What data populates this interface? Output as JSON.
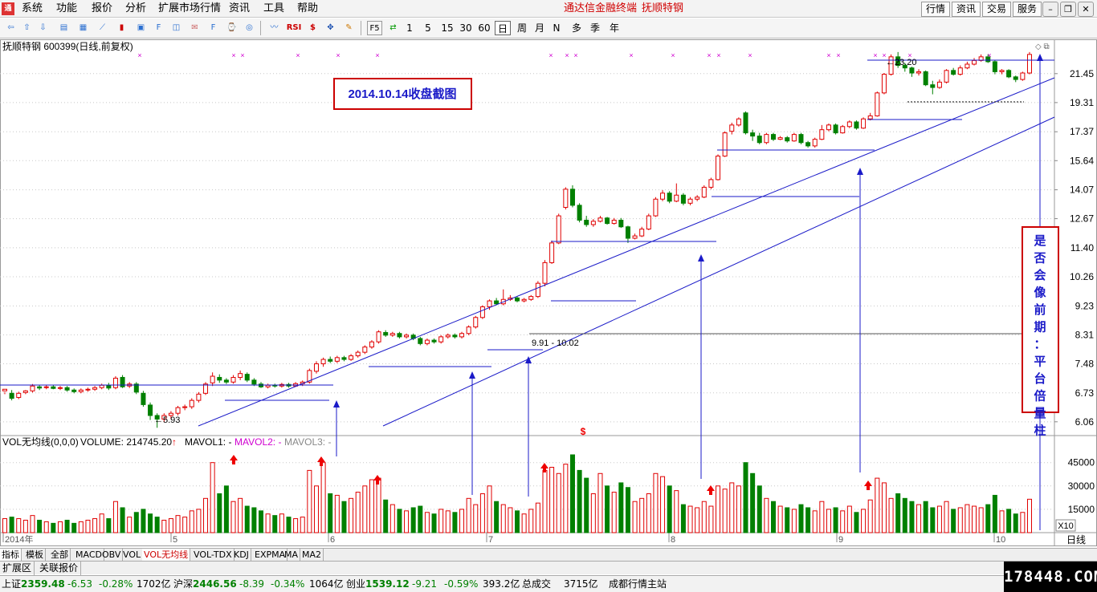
{
  "menu": {
    "items": [
      "系统",
      "功能",
      "报价",
      "分析",
      "扩展市场行情",
      "资讯",
      "工具",
      "帮助"
    ],
    "title_app": "通达信金融终端",
    "title_stock": "抚顺特钢",
    "right_buttons": [
      "行情",
      "资讯",
      "交易",
      "服务"
    ]
  },
  "toolbar": {
    "periods": [
      "1",
      "5",
      "15",
      "30",
      "60",
      "日",
      "周",
      "月",
      "N",
      "多",
      "季",
      "年"
    ],
    "active_period": "日",
    "rsi_label": "RSI",
    "f5_label": "F5"
  },
  "chart": {
    "header": "抚顺特钢 600399(日线,前复权)",
    "annotation_box": "2014.10.14收盘截图",
    "side_note": "是否会像前期：平台倍量柱",
    "low_label": "5.93",
    "high_label": "23.20",
    "gap_label": "9.91 - 10.02",
    "price_ticks": [
      "21.45",
      "19.31",
      "17.37",
      "15.64",
      "14.07",
      "12.67",
      "11.40",
      "10.26",
      "9.23",
      "8.31",
      "7.48",
      "6.73",
      "6.06"
    ],
    "volume_header": {
      "name": "VOL无均线(0,0,0)",
      "volume": "VOLUME: 214745.20",
      "mavol1": "MAVOL1: -",
      "mavol2": "MAVOL2: -",
      "mavol3": "MAVOL3: -"
    },
    "volume_ticks": [
      "45000",
      "30000",
      "15000"
    ],
    "vol_unit": "X10",
    "dollar_mark": "$",
    "date_labels": [
      "2014年",
      "5",
      "6",
      "7",
      "8",
      "9",
      "10"
    ],
    "right_label": "日线"
  },
  "chart_data": {
    "type": "candlestick",
    "title": "抚顺特钢 600399(日线,前复权)",
    "price_scale": "log",
    "ylim": [
      5.9,
      23.6
    ],
    "volume_ylim": [
      0,
      50000
    ],
    "candles": [
      [
        6.78,
        6.82,
        6.75,
        6.7,
        9000,
        1
      ],
      [
        6.72,
        6.6,
        6.8,
        6.55,
        10000,
        0
      ],
      [
        6.62,
        6.72,
        6.76,
        6.58,
        9000,
        1
      ],
      [
        6.74,
        6.78,
        6.8,
        6.7,
        8000,
        1
      ],
      [
        6.78,
        6.9,
        6.95,
        6.74,
        11000,
        1
      ],
      [
        6.88,
        6.85,
        6.92,
        6.8,
        8000,
        0
      ],
      [
        6.86,
        6.88,
        6.92,
        6.82,
        7000,
        1
      ],
      [
        6.88,
        6.84,
        6.92,
        6.82,
        6000,
        0
      ],
      [
        6.84,
        6.86,
        6.9,
        6.8,
        7000,
        1
      ],
      [
        6.86,
        6.8,
        6.9,
        6.76,
        8000,
        0
      ],
      [
        6.8,
        6.76,
        6.84,
        6.72,
        6000,
        0
      ],
      [
        6.76,
        6.8,
        6.84,
        6.72,
        7000,
        1
      ],
      [
        6.8,
        6.82,
        6.86,
        6.76,
        8000,
        1
      ],
      [
        6.82,
        6.86,
        6.9,
        6.78,
        9000,
        1
      ],
      [
        6.86,
        6.92,
        6.96,
        6.82,
        12000,
        1
      ],
      [
        6.92,
        6.85,
        6.98,
        6.8,
        9000,
        0
      ],
      [
        6.86,
        7.1,
        7.15,
        6.82,
        20000,
        1
      ],
      [
        7.12,
        6.88,
        7.18,
        6.85,
        16000,
        0
      ],
      [
        6.9,
        6.95,
        7.0,
        6.85,
        10000,
        1
      ],
      [
        6.95,
        6.75,
        7.0,
        6.7,
        13000,
        0
      ],
      [
        6.72,
        6.45,
        6.78,
        6.4,
        15000,
        0
      ],
      [
        6.44,
        6.2,
        6.5,
        6.1,
        12000,
        0
      ],
      [
        6.2,
        6.12,
        6.25,
        5.93,
        10000,
        0
      ],
      [
        6.12,
        6.2,
        6.25,
        6.05,
        8000,
        1
      ],
      [
        6.2,
        6.25,
        6.3,
        6.12,
        9000,
        1
      ],
      [
        6.25,
        6.38,
        6.42,
        6.2,
        11000,
        1
      ],
      [
        6.38,
        6.4,
        6.45,
        6.32,
        10000,
        1
      ],
      [
        6.4,
        6.55,
        6.6,
        6.35,
        14000,
        1
      ],
      [
        6.55,
        6.7,
        6.75,
        6.5,
        15000,
        1
      ],
      [
        6.72,
        6.95,
        7.0,
        6.68,
        22000,
        1
      ],
      [
        6.98,
        7.15,
        7.25,
        6.9,
        45000,
        1
      ],
      [
        7.12,
        7.05,
        7.2,
        6.98,
        25000,
        0
      ],
      [
        7.05,
        7.0,
        7.1,
        6.95,
        30000,
        0
      ],
      [
        7.0,
        7.12,
        7.18,
        6.96,
        20000,
        1
      ],
      [
        7.12,
        7.22,
        7.3,
        7.05,
        22000,
        1
      ],
      [
        7.2,
        7.05,
        7.25,
        7.0,
        17000,
        0
      ],
      [
        7.05,
        6.95,
        7.1,
        6.9,
        16000,
        0
      ],
      [
        6.95,
        6.88,
        7.0,
        6.85,
        14000,
        0
      ],
      [
        6.88,
        6.92,
        6.96,
        6.84,
        12000,
        1
      ],
      [
        6.92,
        6.9,
        6.96,
        6.86,
        11000,
        0
      ],
      [
        6.9,
        6.94,
        6.98,
        6.86,
        12000,
        1
      ],
      [
        6.94,
        6.9,
        6.98,
        6.86,
        10000,
        0
      ],
      [
        6.9,
        6.96,
        7.0,
        6.88,
        9000,
        1
      ],
      [
        6.96,
        7.0,
        7.04,
        6.9,
        10000,
        1
      ],
      [
        7.0,
        7.3,
        7.35,
        6.96,
        40000,
        1
      ],
      [
        7.28,
        7.48,
        7.55,
        7.22,
        30000,
        1
      ],
      [
        7.48,
        7.6,
        7.65,
        7.4,
        45000,
        1
      ],
      [
        7.6,
        7.55,
        7.68,
        7.5,
        25000,
        0
      ],
      [
        7.55,
        7.65,
        7.7,
        7.5,
        24000,
        1
      ],
      [
        7.65,
        7.6,
        7.7,
        7.55,
        20000,
        0
      ],
      [
        7.6,
        7.7,
        7.75,
        7.56,
        22000,
        1
      ],
      [
        7.7,
        7.8,
        7.85,
        7.65,
        26000,
        1
      ],
      [
        7.8,
        7.95,
        8.0,
        7.75,
        30000,
        1
      ],
      [
        7.95,
        8.1,
        8.15,
        7.9,
        34000,
        1
      ],
      [
        8.1,
        8.4,
        8.45,
        8.05,
        35000,
        1
      ],
      [
        8.38,
        8.3,
        8.45,
        8.25,
        21000,
        0
      ],
      [
        8.3,
        8.35,
        8.4,
        8.25,
        18000,
        1
      ],
      [
        8.35,
        8.25,
        8.4,
        8.2,
        15000,
        0
      ],
      [
        8.25,
        8.3,
        8.35,
        8.2,
        14000,
        1
      ],
      [
        8.3,
        8.2,
        8.35,
        8.15,
        16000,
        0
      ],
      [
        8.2,
        8.05,
        8.25,
        8.0,
        17000,
        0
      ],
      [
        8.05,
        8.15,
        8.2,
        8.0,
        13000,
        1
      ],
      [
        8.15,
        8.1,
        8.2,
        8.05,
        12000,
        0
      ],
      [
        8.1,
        8.25,
        8.3,
        8.05,
        15000,
        1
      ],
      [
        8.25,
        8.3,
        8.35,
        8.2,
        14000,
        1
      ],
      [
        8.3,
        8.25,
        8.35,
        8.2,
        13000,
        0
      ],
      [
        8.25,
        8.35,
        8.4,
        8.2,
        15000,
        1
      ],
      [
        8.35,
        8.55,
        8.6,
        8.3,
        22000,
        1
      ],
      [
        8.55,
        8.85,
        8.9,
        8.5,
        18000,
        1
      ],
      [
        8.85,
        9.2,
        9.25,
        8.8,
        25000,
        1
      ],
      [
        9.2,
        9.4,
        9.45,
        9.1,
        30000,
        1
      ],
      [
        9.4,
        9.3,
        9.5,
        9.25,
        20000,
        0
      ],
      [
        9.3,
        9.45,
        9.8,
        9.25,
        18000,
        1
      ],
      [
        9.45,
        9.5,
        9.6,
        9.4,
        16000,
        1
      ],
      [
        9.5,
        9.4,
        9.55,
        9.35,
        14000,
        0
      ],
      [
        9.4,
        9.45,
        9.5,
        9.35,
        12000,
        1
      ],
      [
        9.45,
        9.55,
        9.6,
        9.4,
        15000,
        1
      ],
      [
        9.55,
        10.02,
        10.1,
        9.5,
        19000,
        1
      ],
      [
        10.02,
        10.8,
        10.9,
        9.91,
        40000,
        1
      ],
      [
        10.8,
        11.6,
        11.7,
        10.75,
        42000,
        1
      ],
      [
        11.6,
        12.8,
        12.9,
        11.55,
        38000,
        1
      ],
      [
        13.2,
        14.1,
        14.2,
        13.1,
        44000,
        1
      ],
      [
        14.1,
        13.3,
        14.3,
        13.2,
        50000,
        0
      ],
      [
        13.3,
        12.6,
        13.4,
        12.5,
        40000,
        0
      ],
      [
        12.6,
        12.4,
        12.8,
        12.3,
        35000,
        0
      ],
      [
        12.4,
        12.55,
        12.65,
        12.3,
        25000,
        1
      ],
      [
        12.55,
        12.7,
        12.8,
        12.5,
        38000,
        1
      ],
      [
        12.7,
        12.45,
        12.75,
        12.4,
        30000,
        0
      ],
      [
        12.45,
        12.6,
        12.7,
        12.4,
        26000,
        1
      ],
      [
        12.6,
        12.3,
        12.7,
        12.25,
        32000,
        0
      ],
      [
        12.3,
        11.8,
        12.35,
        11.6,
        29000,
        0
      ],
      [
        11.8,
        11.9,
        12.0,
        11.75,
        20000,
        1
      ],
      [
        11.9,
        12.2,
        12.3,
        11.85,
        22000,
        1
      ],
      [
        12.2,
        12.8,
        12.9,
        12.15,
        25000,
        1
      ],
      [
        12.8,
        13.6,
        13.7,
        12.75,
        38000,
        1
      ],
      [
        13.6,
        13.9,
        14.05,
        13.5,
        36000,
        1
      ],
      [
        13.9,
        13.5,
        14.0,
        13.4,
        30000,
        0
      ],
      [
        13.5,
        13.8,
        14.4,
        13.45,
        27000,
        1
      ],
      [
        13.8,
        13.4,
        13.9,
        13.3,
        18000,
        0
      ],
      [
        13.4,
        13.6,
        13.7,
        13.3,
        17000,
        1
      ],
      [
        13.6,
        13.7,
        13.8,
        13.5,
        16000,
        1
      ],
      [
        13.7,
        14.2,
        14.3,
        13.65,
        20000,
        1
      ],
      [
        14.2,
        14.6,
        14.7,
        14.1,
        17000,
        1
      ],
      [
        14.6,
        15.9,
        16.0,
        14.55,
        30000,
        1
      ],
      [
        15.9,
        17.3,
        17.4,
        15.85,
        28000,
        1
      ],
      [
        17.4,
        17.8,
        17.95,
        17.2,
        32000,
        1
      ],
      [
        17.8,
        18.2,
        18.3,
        17.7,
        30000,
        1
      ],
      [
        18.6,
        17.3,
        18.7,
        17.2,
        45000,
        0
      ],
      [
        17.3,
        17.1,
        17.5,
        16.8,
        38000,
        0
      ],
      [
        17.1,
        16.7,
        17.3,
        16.6,
        30000,
        0
      ],
      [
        16.7,
        17.2,
        17.3,
        16.6,
        22000,
        1
      ],
      [
        17.2,
        16.9,
        17.3,
        16.8,
        20000,
        0
      ],
      [
        16.9,
        17.0,
        17.1,
        16.85,
        17000,
        1
      ],
      [
        17.0,
        16.8,
        17.1,
        16.7,
        16000,
        0
      ],
      [
        16.8,
        17.2,
        17.3,
        16.75,
        15000,
        1
      ],
      [
        17.2,
        16.7,
        17.3,
        16.6,
        18000,
        0
      ],
      [
        16.7,
        16.5,
        16.8,
        16.4,
        16000,
        0
      ],
      [
        16.5,
        16.9,
        17.0,
        16.4,
        14000,
        1
      ],
      [
        16.9,
        17.5,
        17.8,
        16.85,
        20000,
        1
      ],
      [
        17.5,
        17.8,
        17.9,
        17.4,
        15000,
        1
      ],
      [
        17.8,
        17.3,
        17.9,
        17.2,
        16000,
        0
      ],
      [
        17.3,
        17.7,
        17.8,
        17.25,
        14000,
        1
      ],
      [
        17.7,
        18.0,
        18.1,
        17.6,
        17000,
        1
      ],
      [
        18.0,
        17.6,
        18.1,
        17.5,
        13000,
        0
      ],
      [
        17.6,
        18.2,
        18.3,
        17.55,
        15000,
        1
      ],
      [
        18.2,
        18.4,
        18.6,
        18.1,
        21000,
        1
      ],
      [
        18.4,
        20.0,
        20.1,
        18.35,
        35000,
        1
      ],
      [
        20.0,
        21.4,
        21.5,
        19.9,
        32000,
        1
      ],
      [
        21.4,
        22.8,
        23.0,
        21.3,
        22000,
        1
      ],
      [
        22.8,
        22.1,
        23.2,
        21.9,
        25000,
        0
      ],
      [
        22.1,
        21.9,
        22.3,
        21.6,
        22000,
        0
      ],
      [
        21.9,
        21.5,
        22.0,
        21.2,
        20000,
        0
      ],
      [
        21.5,
        21.6,
        21.8,
        21.3,
        18000,
        1
      ],
      [
        21.6,
        20.6,
        21.7,
        20.5,
        20000,
        0
      ],
      [
        20.6,
        20.4,
        20.9,
        19.9,
        16000,
        0
      ],
      [
        20.4,
        20.8,
        21.0,
        20.3,
        17000,
        1
      ],
      [
        20.8,
        21.7,
        21.8,
        20.7,
        20000,
        1
      ],
      [
        21.7,
        21.4,
        21.9,
        21.3,
        15000,
        0
      ],
      [
        21.4,
        21.9,
        22.1,
        21.3,
        16000,
        1
      ],
      [
        21.9,
        22.2,
        22.4,
        21.8,
        18000,
        1
      ],
      [
        22.2,
        22.5,
        22.7,
        22.1,
        17000,
        1
      ],
      [
        22.5,
        22.8,
        23.0,
        22.4,
        16000,
        1
      ],
      [
        22.8,
        22.4,
        23.0,
        22.3,
        18000,
        0
      ],
      [
        22.4,
        21.6,
        22.5,
        21.4,
        24000,
        0
      ],
      [
        21.6,
        21.7,
        21.8,
        21.4,
        14000,
        1
      ],
      [
        21.7,
        21.2,
        21.8,
        21.1,
        15000,
        0
      ],
      [
        21.2,
        21.0,
        21.3,
        20.8,
        12000,
        0
      ],
      [
        21.0,
        21.5,
        21.6,
        20.9,
        13000,
        1
      ],
      [
        21.5,
        23.0,
        23.2,
        21.4,
        21475,
        1
      ]
    ],
    "columns": [
      "open",
      "close",
      "high",
      "low",
      "volume",
      "up"
    ]
  }
}
